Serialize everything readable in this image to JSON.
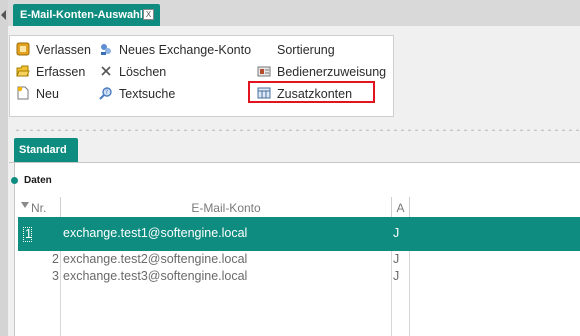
{
  "window": {
    "tab_title": "E-Mail-Konten-Auswahl",
    "tab_close": "X"
  },
  "ribbon": {
    "col1": [
      {
        "label": "Verlassen",
        "icon": "exit-icon"
      },
      {
        "label": "Erfassen",
        "icon": "folder-icon"
      },
      {
        "label": "Neu",
        "icon": "new-document-icon"
      }
    ],
    "col2": [
      {
        "label": "Neues Exchange-Konto",
        "icon": "exchange-account-icon"
      },
      {
        "label": "Löschen",
        "icon": "delete-icon"
      },
      {
        "label": "Textsuche",
        "icon": "text-search-icon"
      }
    ],
    "col3": [
      {
        "label": "Sortierung",
        "icon": ""
      },
      {
        "label": "Bedienerzuweisung",
        "icon": "user-assignment-icon"
      },
      {
        "label": "Zusatzkonten",
        "icon": "additional-accounts-icon"
      }
    ]
  },
  "subtab": {
    "label": "Standard"
  },
  "section": {
    "title": "Daten"
  },
  "grid": {
    "columns": [
      "Nr.",
      "E-Mail-Konto",
      "A"
    ],
    "rows": [
      {
        "nr": "1",
        "email": "exchange.test1@softengine.local",
        "a": "J"
      },
      {
        "nr": "2",
        "email": "exchange.test2@softengine.local",
        "a": "J"
      },
      {
        "nr": "3",
        "email": "exchange.test3@softengine.local",
        "a": "J"
      }
    ]
  },
  "colors": {
    "accent": "#0f8c80",
    "highlight_border": "#e0151f"
  }
}
